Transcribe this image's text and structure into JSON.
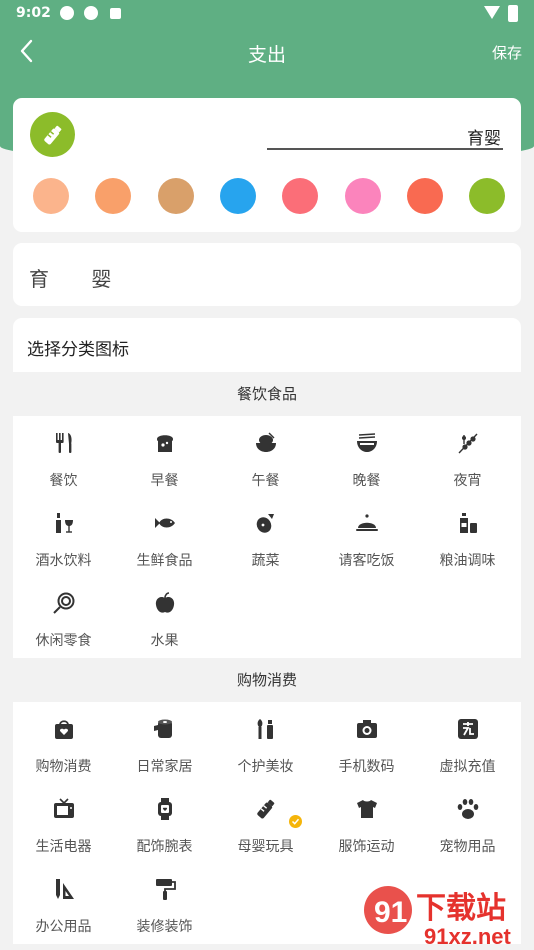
{
  "status": {
    "time": "9:02"
  },
  "nav": {
    "title": "支出",
    "save": "保存"
  },
  "editor": {
    "name_value": "育婴",
    "selected_color": "#8cbc2a",
    "colors": [
      "#fbb48c",
      "#f9a06a",
      "#d9a06a",
      "#27a4ee",
      "#fb6e78",
      "#fb84bc",
      "#f96a51",
      "#8cbc2a"
    ]
  },
  "preview": {
    "label": "育 婴"
  },
  "picker": {
    "title": "选择分类图标"
  },
  "sections": [
    {
      "title": "餐饮食品",
      "items": [
        {
          "label": "餐饮",
          "icon": "fork-knife-icon"
        },
        {
          "label": "早餐",
          "icon": "toast-icon"
        },
        {
          "label": "午餐",
          "icon": "rice-bowl-icon"
        },
        {
          "label": "晚餐",
          "icon": "noodle-bowl-icon"
        },
        {
          "label": "夜宵",
          "icon": "skewer-icon"
        },
        {
          "label": "酒水饮料",
          "icon": "wine-icon"
        },
        {
          "label": "生鲜食品",
          "icon": "fish-icon"
        },
        {
          "label": "蔬菜",
          "icon": "eggplant-icon"
        },
        {
          "label": "请客吃饭",
          "icon": "cloche-icon"
        },
        {
          "label": "粮油调味",
          "icon": "oil-bottle-icon"
        },
        {
          "label": "休闲零食",
          "icon": "lollipop-icon"
        },
        {
          "label": "水果",
          "icon": "apple-icon"
        }
      ]
    },
    {
      "title": "购物消费",
      "items": [
        {
          "label": "购物消费",
          "icon": "shopping-bag-icon"
        },
        {
          "label": "日常家居",
          "icon": "tissue-roll-icon"
        },
        {
          "label": "个护美妆",
          "icon": "makeup-brush-icon"
        },
        {
          "label": "手机数码",
          "icon": "camera-icon"
        },
        {
          "label": "虚拟充值",
          "icon": "recharge-icon"
        },
        {
          "label": "生活电器",
          "icon": "tv-icon"
        },
        {
          "label": "配饰腕表",
          "icon": "watch-icon"
        },
        {
          "label": "母婴玩具",
          "icon": "baby-bottle-icon"
        },
        {
          "label": "服饰运动",
          "icon": "tshirt-icon"
        },
        {
          "label": "宠物用品",
          "icon": "paw-icon"
        },
        {
          "label": "办公用品",
          "icon": "pencil-ruler-icon"
        },
        {
          "label": "装修装饰",
          "icon": "paint-roller-icon"
        }
      ]
    }
  ],
  "watermark": {
    "title": "下载站",
    "url": "91xz.net"
  }
}
